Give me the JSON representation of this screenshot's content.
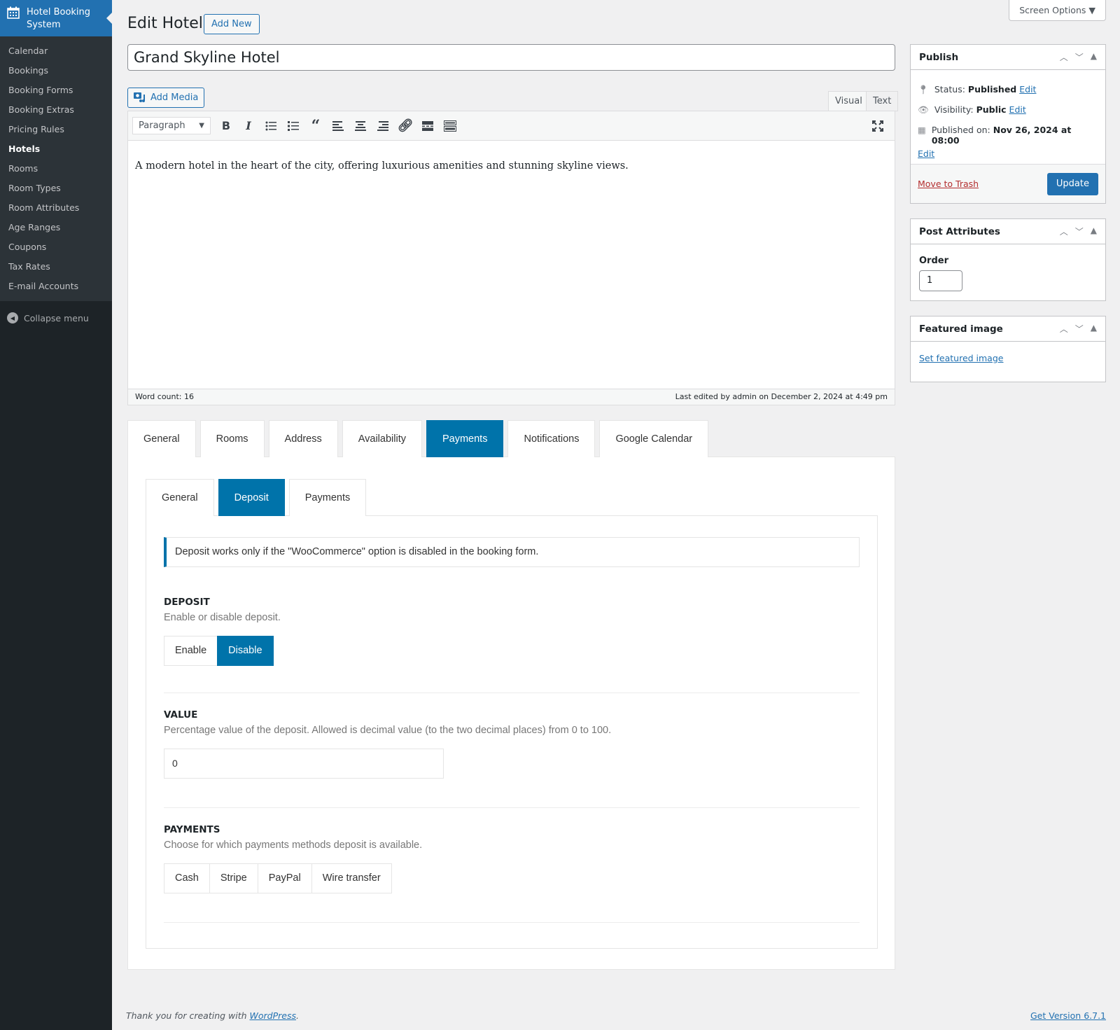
{
  "sidebar": {
    "header": "Hotel Booking System",
    "items": [
      {
        "label": "Calendar"
      },
      {
        "label": "Bookings"
      },
      {
        "label": "Booking Forms"
      },
      {
        "label": "Booking Extras"
      },
      {
        "label": "Pricing Rules"
      },
      {
        "label": "Hotels"
      },
      {
        "label": "Rooms"
      },
      {
        "label": "Room Types"
      },
      {
        "label": "Room Attributes"
      },
      {
        "label": "Age Ranges"
      },
      {
        "label": "Coupons"
      },
      {
        "label": "Tax Rates"
      },
      {
        "label": "E-mail Accounts"
      }
    ],
    "collapse": "Collapse menu"
  },
  "screen_options": "Screen Options",
  "header": {
    "title": "Edit Hotel",
    "add_new": "Add New"
  },
  "post_title": "Grand Skyline Hotel",
  "editor": {
    "add_media": "Add Media",
    "tab_visual": "Visual",
    "tab_text": "Text",
    "format": "Paragraph",
    "content": "A modern hotel in the heart of the city, offering luxurious amenities and stunning skyline views.",
    "word_count": "Word count: 16",
    "last_edited": "Last edited by admin on December 2, 2024 at 4:49 pm"
  },
  "main_tabs": [
    "General",
    "Rooms",
    "Address",
    "Availability",
    "Payments",
    "Notifications",
    "Google Calendar"
  ],
  "sub_tabs": [
    "General",
    "Deposit",
    "Payments"
  ],
  "notice": "Deposit works only if the \"WooCommerce\" option is disabled in the booking form.",
  "deposit": {
    "title": "DEPOSIT",
    "desc": "Enable or disable deposit.",
    "options": [
      "Enable",
      "Disable"
    ],
    "selected": "Disable"
  },
  "value": {
    "title": "VALUE",
    "desc": "Percentage value of the deposit. Allowed is decimal value (to the two decimal places) from 0 to 100.",
    "value": "0"
  },
  "payments": {
    "title": "PAYMENTS",
    "desc": "Choose for which payments methods deposit is available.",
    "options": [
      "Cash",
      "Stripe",
      "PayPal",
      "Wire transfer"
    ]
  },
  "publish": {
    "title": "Publish",
    "status_label": "Status:",
    "status": "Published",
    "visibility_label": "Visibility:",
    "visibility": "Public",
    "published_label": "Published on:",
    "published": "Nov 26, 2024 at 08:00",
    "edit": "Edit",
    "trash": "Move to Trash",
    "update": "Update"
  },
  "post_attributes": {
    "title": "Post Attributes",
    "order_label": "Order",
    "order": "1"
  },
  "featured": {
    "title": "Featured image",
    "set": "Set featured image"
  },
  "footer": {
    "thanks": "Thank you for creating with ",
    "wp": "WordPress",
    "dot": ".",
    "version": "Get Version 6.7.1"
  }
}
